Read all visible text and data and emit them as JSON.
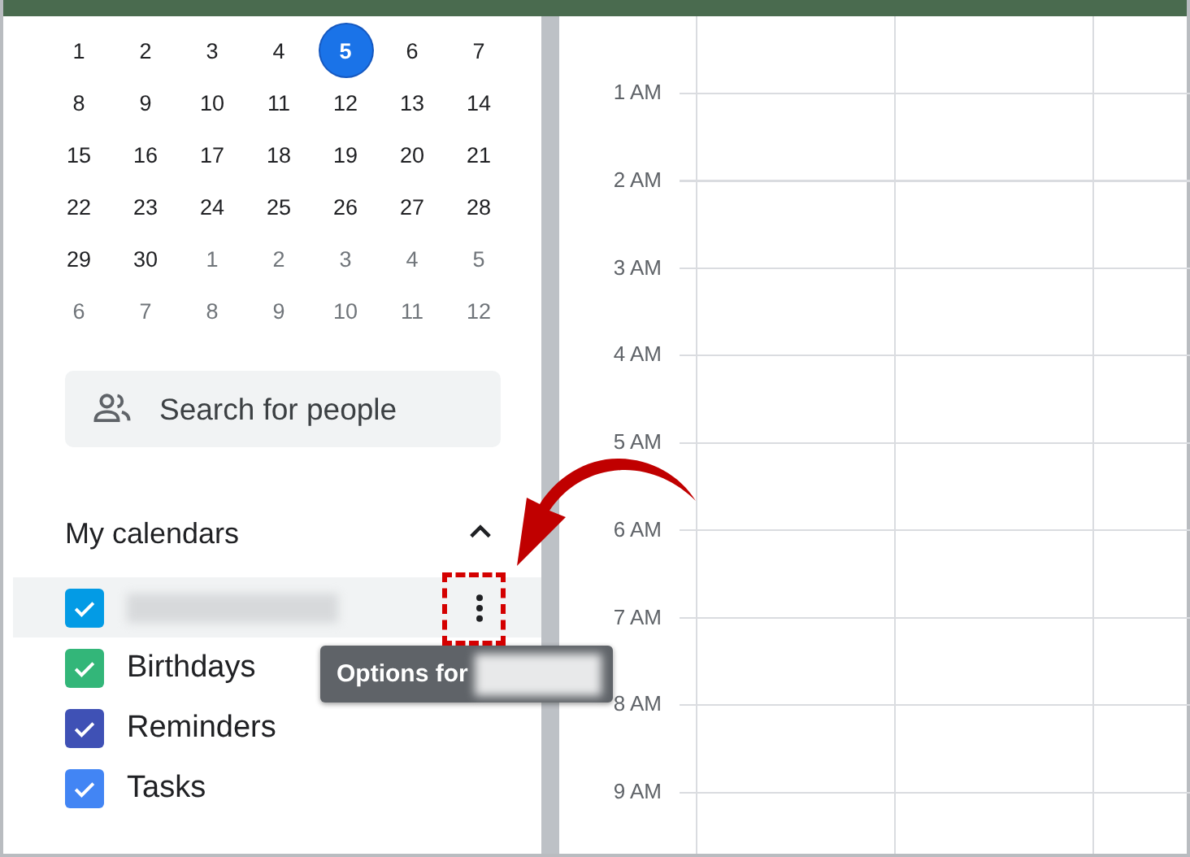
{
  "mini_calendar": {
    "days": [
      {
        "label": "1",
        "in_month": true,
        "selected": false
      },
      {
        "label": "2",
        "in_month": true,
        "selected": false
      },
      {
        "label": "3",
        "in_month": true,
        "selected": false
      },
      {
        "label": "4",
        "in_month": true,
        "selected": false
      },
      {
        "label": "5",
        "in_month": true,
        "selected": true
      },
      {
        "label": "6",
        "in_month": true,
        "selected": false
      },
      {
        "label": "7",
        "in_month": true,
        "selected": false
      },
      {
        "label": "8",
        "in_month": true,
        "selected": false
      },
      {
        "label": "9",
        "in_month": true,
        "selected": false
      },
      {
        "label": "10",
        "in_month": true,
        "selected": false
      },
      {
        "label": "11",
        "in_month": true,
        "selected": false
      },
      {
        "label": "12",
        "in_month": true,
        "selected": false
      },
      {
        "label": "13",
        "in_month": true,
        "selected": false
      },
      {
        "label": "14",
        "in_month": true,
        "selected": false
      },
      {
        "label": "15",
        "in_month": true,
        "selected": false
      },
      {
        "label": "16",
        "in_month": true,
        "selected": false
      },
      {
        "label": "17",
        "in_month": true,
        "selected": false
      },
      {
        "label": "18",
        "in_month": true,
        "selected": false
      },
      {
        "label": "19",
        "in_month": true,
        "selected": false
      },
      {
        "label": "20",
        "in_month": true,
        "selected": false
      },
      {
        "label": "21",
        "in_month": true,
        "selected": false
      },
      {
        "label": "22",
        "in_month": true,
        "selected": false
      },
      {
        "label": "23",
        "in_month": true,
        "selected": false
      },
      {
        "label": "24",
        "in_month": true,
        "selected": false
      },
      {
        "label": "25",
        "in_month": true,
        "selected": false
      },
      {
        "label": "26",
        "in_month": true,
        "selected": false
      },
      {
        "label": "27",
        "in_month": true,
        "selected": false
      },
      {
        "label": "28",
        "in_month": true,
        "selected": false
      },
      {
        "label": "29",
        "in_month": true,
        "selected": false
      },
      {
        "label": "30",
        "in_month": true,
        "selected": false
      },
      {
        "label": "1",
        "in_month": false,
        "selected": false
      },
      {
        "label": "2",
        "in_month": false,
        "selected": false
      },
      {
        "label": "3",
        "in_month": false,
        "selected": false
      },
      {
        "label": "4",
        "in_month": false,
        "selected": false
      },
      {
        "label": "5",
        "in_month": false,
        "selected": false
      },
      {
        "label": "6",
        "in_month": false,
        "selected": false
      },
      {
        "label": "7",
        "in_month": false,
        "selected": false
      },
      {
        "label": "8",
        "in_month": false,
        "selected": false
      },
      {
        "label": "9",
        "in_month": false,
        "selected": false
      },
      {
        "label": "10",
        "in_month": false,
        "selected": false
      },
      {
        "label": "11",
        "in_month": false,
        "selected": false
      },
      {
        "label": "12",
        "in_month": false,
        "selected": false
      }
    ]
  },
  "search": {
    "placeholder": "Search for people"
  },
  "my_calendars": {
    "title": "My calendars",
    "expanded": true,
    "items": [
      {
        "redacted": true,
        "checked": true,
        "hovered": true,
        "color": "#039be5"
      },
      {
        "label": "Birthdays",
        "checked": true,
        "hovered": false,
        "color": "#33b679"
      },
      {
        "label": "Reminders",
        "checked": true,
        "hovered": false,
        "color": "#3f51b5"
      },
      {
        "label": "Tasks",
        "checked": true,
        "hovered": false,
        "color": "#4285f4"
      }
    ]
  },
  "tooltip": {
    "text": "Options for",
    "redacted": true
  },
  "time_labels": [
    "1 AM",
    "2 AM",
    "3 AM",
    "4 AM",
    "5 AM",
    "6 AM",
    "7 AM",
    "8 AM",
    "9 AM"
  ],
  "annotations": {
    "arrow": true,
    "highlight_box": true
  }
}
